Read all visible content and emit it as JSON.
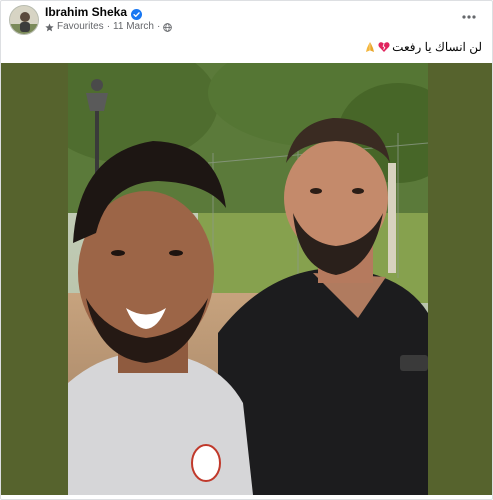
{
  "post": {
    "author_name": "Ibrahim Sheka",
    "audience": "Favourites",
    "separator": "·",
    "date": "11 March",
    "caption_text": "لن انساك يا رفعت",
    "icons": {
      "avatar": "profile-photo",
      "verified": "verified-badge-icon",
      "favourites": "star-icon",
      "privacy": "globe-icon",
      "more": "more-options-icon",
      "heart": "broken-heart-emoji",
      "pray": "folded-hands-emoji"
    },
    "colors": {
      "verified_blue": "#1877f2",
      "meta_gray": "#65676b",
      "media_backdrop": "#56632d"
    }
  }
}
